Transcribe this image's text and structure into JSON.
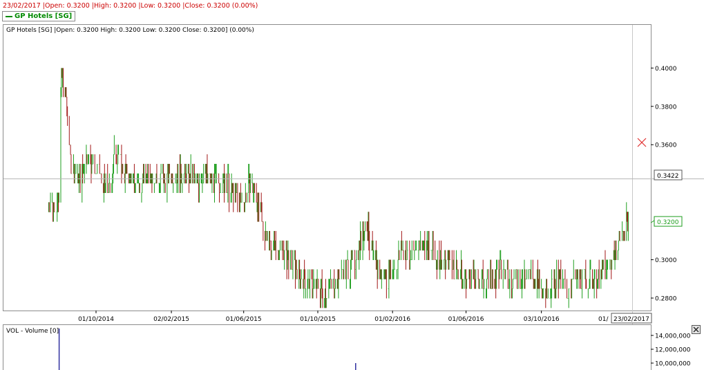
{
  "header": {
    "info_line": "23/02/2017 |Open: 0.3200 |High: 0.3200 |Low: 0.3200 |Close: 0.3200 (0.00%)",
    "legend_label": "GP Hotels [SG]"
  },
  "price_panel": {
    "title": "GP Hotels [SG] |Open: 0.3200  High: 0.3200  Low: 0.3200  Close: 0.3200] (0.00%)",
    "crosshair_value": "0.3422",
    "last_price": "0.3200",
    "date_marker": "23/02/2017",
    "x_tick_last": "01/"
  },
  "volume_panel": {
    "title": "VOL - Volume [0]"
  },
  "colors": {
    "up": "#1e9e1e",
    "down": "#a01414",
    "accent_red": "#cc0000",
    "brand_green": "#008a00"
  },
  "chart_data": [
    {
      "type": "ohlc",
      "title": "GP Hotels [SG]",
      "ylim": [
        0.2735,
        0.4225
      ],
      "yticks": [
        "0.4000",
        "0.3800",
        "0.3600",
        "0.3000",
        "0.2800"
      ],
      "xticks": [
        "01/10/2014",
        "02/02/2015",
        "01/06/2015",
        "01/10/2015",
        "01/02/2016",
        "01/06/2016",
        "03/10/2016"
      ],
      "crosshair_y": 0.3422,
      "last_close": 0.32,
      "close_series": {
        "x": [
          "15/07/2014",
          "25/07/2014",
          "01/08/2014",
          "04/08/2014",
          "08/08/2014",
          "14/08/2014",
          "20/08/2014",
          "27/08/2014",
          "05/09/2014",
          "15/09/2014",
          "25/09/2014",
          "05/10/2014",
          "15/10/2014",
          "25/10/2014",
          "01/11/2014",
          "10/11/2014",
          "20/11/2014",
          "01/12/2014",
          "10/12/2014",
          "20/12/2014",
          "01/01/2015",
          "15/01/2015",
          "01/02/2015",
          "15/02/2015",
          "01/03/2015",
          "15/03/2015",
          "01/04/2015",
          "15/04/2015",
          "01/05/2015",
          "15/05/2015",
          "25/05/2015",
          "01/06/2015",
          "10/06/2015",
          "20/06/2015",
          "01/07/2015",
          "15/07/2015",
          "01/08/2015",
          "15/08/2015",
          "01/09/2015",
          "15/09/2015",
          "01/10/2015",
          "15/10/2015",
          "01/11/2015",
          "15/11/2015",
          "01/12/2015",
          "10/12/2015",
          "20/12/2015",
          "01/01/2016",
          "15/01/2016",
          "01/02/2016",
          "15/02/2016",
          "01/03/2016",
          "15/03/2016",
          "01/04/2016",
          "15/04/2016",
          "01/05/2016",
          "15/05/2016",
          "01/06/2016",
          "15/06/2016",
          "01/07/2016",
          "15/07/2016",
          "01/08/2016",
          "15/08/2016",
          "01/09/2016",
          "15/09/2016",
          "01/10/2016",
          "15/10/2016",
          "01/11/2016",
          "15/11/2016",
          "01/12/2016",
          "15/12/2016",
          "01/01/2017",
          "15/01/2017",
          "01/02/2017",
          "15/02/2017",
          "23/02/2017"
        ],
        "close": [
          0.33,
          0.33,
          0.33,
          0.395,
          0.39,
          0.382,
          0.35,
          0.345,
          0.34,
          0.355,
          0.35,
          0.345,
          0.34,
          0.335,
          0.36,
          0.35,
          0.345,
          0.34,
          0.34,
          0.345,
          0.345,
          0.34,
          0.345,
          0.345,
          0.345,
          0.34,
          0.345,
          0.34,
          0.34,
          0.335,
          0.33,
          0.33,
          0.34,
          0.335,
          0.32,
          0.31,
          0.305,
          0.3,
          0.292,
          0.288,
          0.285,
          0.285,
          0.29,
          0.295,
          0.3,
          0.31,
          0.32,
          0.3,
          0.29,
          0.295,
          0.305,
          0.3,
          0.31,
          0.305,
          0.3,
          0.3,
          0.295,
          0.29,
          0.29,
          0.288,
          0.29,
          0.295,
          0.29,
          0.29,
          0.29,
          0.288,
          0.285,
          0.29,
          0.285,
          0.29,
          0.29,
          0.29,
          0.295,
          0.305,
          0.315,
          0.32
        ]
      }
    },
    {
      "type": "bar",
      "title": "VOL - Volume [0]",
      "yticks": [
        "14,000,000",
        "12,000,000",
        "10,000,000"
      ],
      "ylim": [
        8500000,
        15500000
      ],
      "x": [
        "01/08/2014",
        "02/12/2015"
      ],
      "values": [
        15000000,
        10000000
      ]
    }
  ]
}
